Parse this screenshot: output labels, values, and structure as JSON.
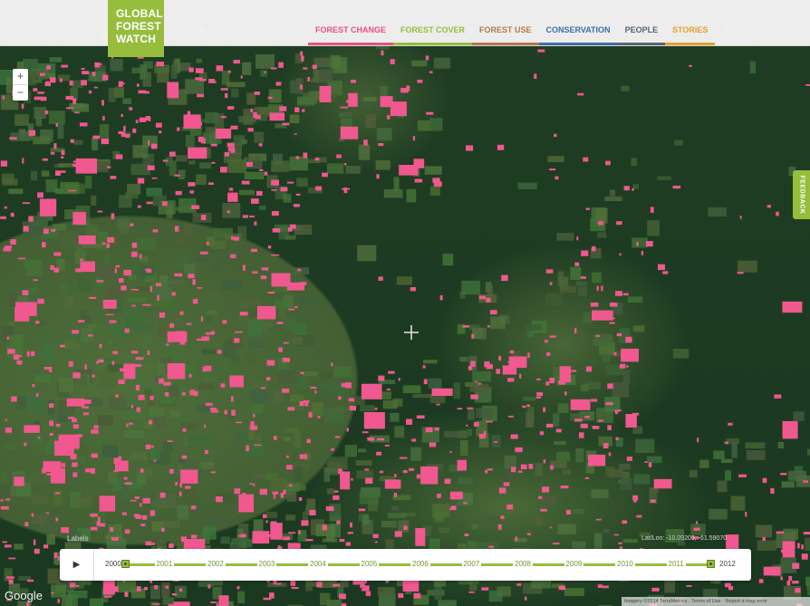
{
  "logo": {
    "lines": [
      "GLOBAL",
      "FOREST",
      "WATCH"
    ]
  },
  "nav": [
    {
      "label": "FOREST CHANGE",
      "color": "#e8527f"
    },
    {
      "label": "FOREST COVER",
      "color": "#97bd3d"
    },
    {
      "label": "FOREST USE",
      "color": "#b4784d"
    },
    {
      "label": "CONSERVATION",
      "color": "#3d6fa6"
    },
    {
      "label": "PEOPLE",
      "color": "#5c6470"
    },
    {
      "label": "STORIES",
      "color": "#e6a02c"
    }
  ],
  "zoom": {
    "in": "+",
    "out": "−"
  },
  "feedback": {
    "label": "FEEDBACK"
  },
  "timeline": {
    "play": "▶",
    "years": [
      "2000",
      "2001",
      "2002",
      "2003",
      "2004",
      "2005",
      "2006",
      "2007",
      "2008",
      "2009",
      "2010",
      "2011",
      "2012"
    ],
    "selection_start": "2000",
    "selection_end": "2012"
  },
  "map": {
    "labels_toggle": "Labels",
    "latlon": "Lat/Lon: -10.09209, -61.59070",
    "google": "Google",
    "attribution": "Imagery ©2014 TerraMetrics · Terms of Use · Report a map error",
    "colors": {
      "loss": "#f0588f",
      "forest": "#1c3a20",
      "cleared": "#4c6c38"
    }
  }
}
